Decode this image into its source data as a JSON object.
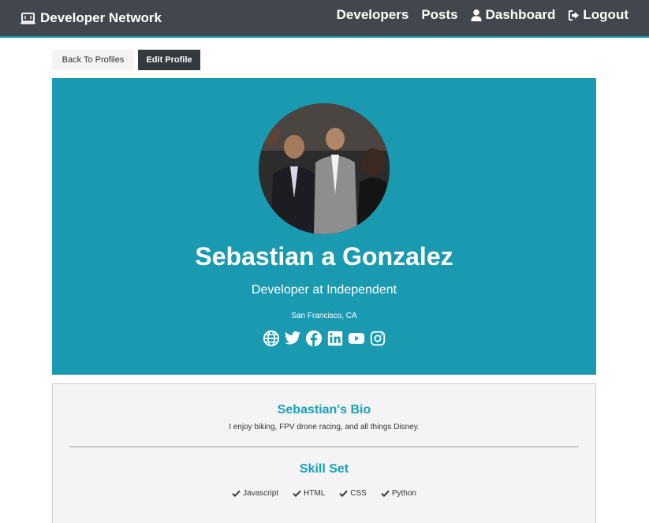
{
  "nav": {
    "brand_icon": "laptop-code-icon",
    "brand": "Developer Network",
    "links": [
      {
        "label": "Developers",
        "icon": ""
      },
      {
        "label": "Posts",
        "icon": ""
      },
      {
        "label": "Dashboard",
        "icon": "user-icon"
      },
      {
        "label": "Logout",
        "icon": "sign-out-icon"
      }
    ]
  },
  "actions": {
    "back_label": "Back To Profiles",
    "edit_label": "Edit Profile"
  },
  "profile": {
    "name": "Sebastian a Gonzalez",
    "title": "Developer at Independent",
    "location": "San Francisco, CA",
    "socials": [
      "globe-icon",
      "twitter-icon",
      "facebook-icon",
      "linkedin-icon",
      "youtube-icon",
      "instagram-icon"
    ]
  },
  "about": {
    "bio_title": "Sebastian's Bio",
    "bio_text": "I enjoy biking, FPV drone racing, and all things Disney.",
    "skills_title": "Skill Set",
    "skills": [
      "Javascript",
      "HTML",
      "CSS",
      "Python"
    ]
  },
  "colors": {
    "navbar": "#343a40",
    "accent": "#17a2b8",
    "profile_bg": "#1a9ab0",
    "light_bg": "#f4f4f4"
  }
}
